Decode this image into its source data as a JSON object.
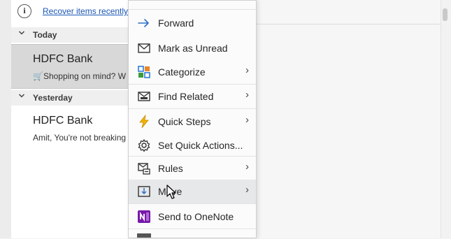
{
  "info_bar": {
    "link_text": "Recover items recently"
  },
  "groups": [
    {
      "label": "Today",
      "chevron": "chevron-down"
    },
    {
      "label": "Yesterday",
      "chevron": "chevron-down"
    }
  ],
  "messages": [
    {
      "sender": "HDFC Bank",
      "preview": "🛒Shopping on mind? W",
      "selected": true
    },
    {
      "sender": "HDFC Bank",
      "preview": "Amit, You're not breaking",
      "selected": false
    }
  ],
  "context_menu": {
    "items": [
      {
        "label": "Forward",
        "icon": "forward-arrow-icon",
        "submenu": false
      },
      {
        "label": "Mark as Unread",
        "icon": "envelope-icon",
        "submenu": false
      },
      {
        "label": "Categorize",
        "icon": "categorize-grid-icon",
        "submenu": true
      },
      {
        "label": "Find Related",
        "icon": "find-related-envelope-icon",
        "submenu": true
      },
      {
        "label": "Quick Steps",
        "icon": "lightning-icon",
        "submenu": true
      },
      {
        "label": "Set Quick Actions...",
        "icon": "gear-icon",
        "submenu": false
      },
      {
        "label": "Rules",
        "icon": "rules-icon",
        "submenu": true
      },
      {
        "label": "Move",
        "icon": "move-to-folder-icon",
        "submenu": true,
        "hovered": true
      },
      {
        "label": "Send to OneNote",
        "icon": "onenote-icon",
        "submenu": false
      }
    ],
    "submenu_glyph": "›"
  },
  "colors": {
    "link": "#1a57b5",
    "onenote": "#7719aa",
    "lightning": "#f2b200",
    "categorize_blue": "#2f7bd8",
    "categorize_orange": "#e8862a",
    "categorize_green": "#3a9d3a"
  }
}
